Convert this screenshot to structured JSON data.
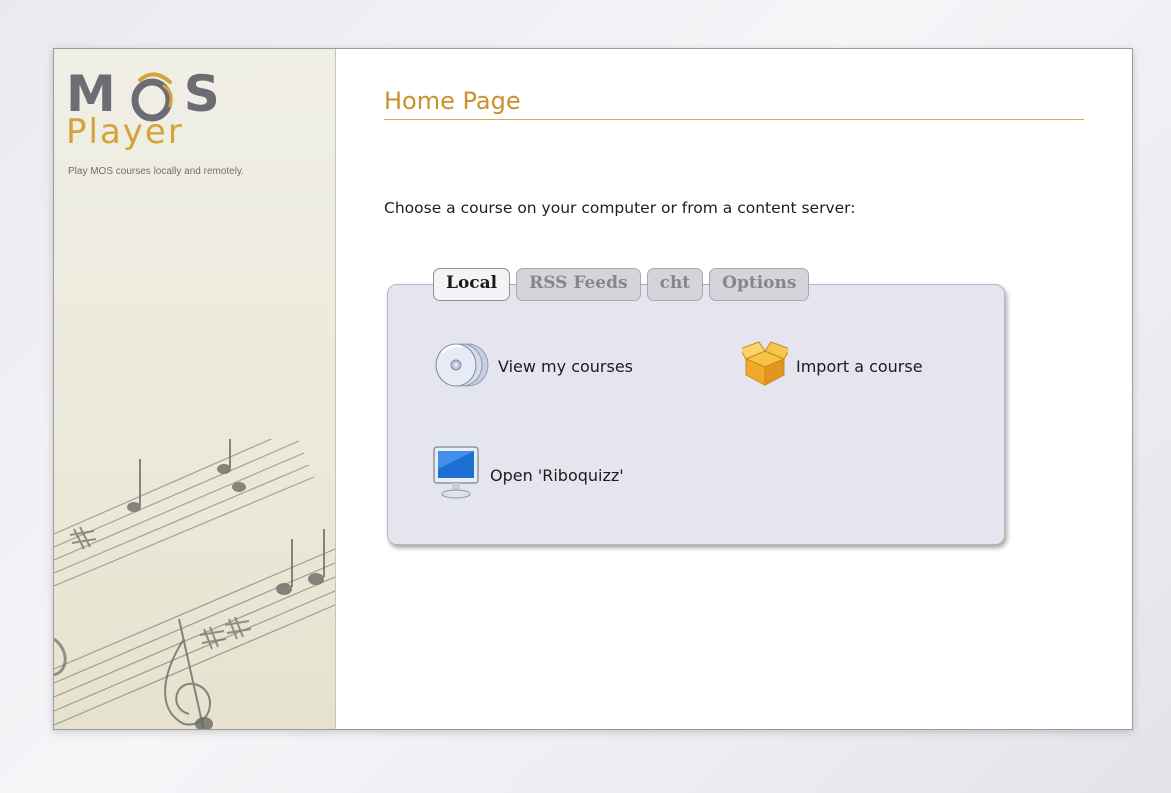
{
  "sidebar": {
    "logo_mos": "MOS",
    "logo_player": "Player",
    "tagline": "Play MOS courses locally and remotely."
  },
  "main": {
    "title": "Home Page",
    "intro": "Choose a course on your computer or from a content server:",
    "tabs": [
      {
        "label": "Local",
        "active": true
      },
      {
        "label": "RSS Feeds",
        "active": false
      },
      {
        "label": "cht",
        "active": false
      },
      {
        "label": "Options",
        "active": false
      }
    ],
    "actions": [
      {
        "label": "View my courses",
        "icon": "cd-stack-icon"
      },
      {
        "label": "Import a course",
        "icon": "box-icon"
      },
      {
        "label": "Open 'Riboquizz'",
        "icon": "monitor-icon"
      }
    ]
  },
  "colors": {
    "title": "#c8922d",
    "logo_gray": "#6d6c74",
    "logo_gold": "#d6a338",
    "panel_bg": "#e4e5ee"
  }
}
